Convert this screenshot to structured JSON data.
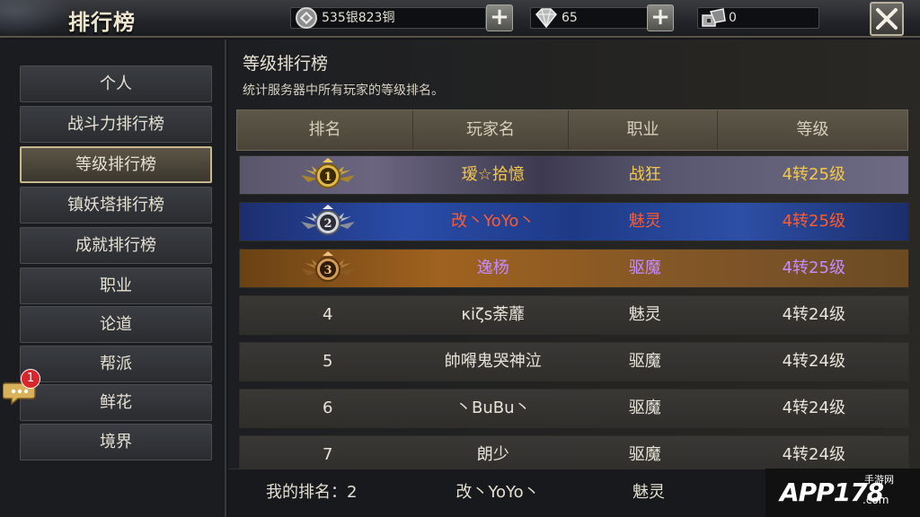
{
  "header": {
    "title": "排行榜",
    "silver": "535银823铜",
    "diamond": "65",
    "tickets": "0",
    "close_icon": "close-icon",
    "coin_icon": "silver-coin-icon",
    "diamond_icon": "diamond-icon",
    "ticket_icon": "ticket-icon"
  },
  "sidebar": {
    "items": [
      {
        "label": "个人",
        "active": false
      },
      {
        "label": "战斗力排行榜",
        "active": false
      },
      {
        "label": "等级排行榜",
        "active": true
      },
      {
        "label": "镇妖塔排行榜",
        "active": false
      },
      {
        "label": "成就排行榜",
        "active": false
      },
      {
        "label": "职业",
        "active": false
      },
      {
        "label": "论道",
        "active": false
      },
      {
        "label": "帮派",
        "active": false
      },
      {
        "label": "鲜花",
        "active": false
      },
      {
        "label": "境界",
        "active": false
      }
    ],
    "chat_badge": "1"
  },
  "main": {
    "title": "等级排行榜",
    "description": "统计服务器中所有玩家的等级排名。",
    "columns": [
      "排名",
      "玩家名",
      "职业",
      "等级"
    ],
    "rows": [
      {
        "rank": "1",
        "name": "瑷☆拾憶",
        "job": "战狂",
        "level": "4转25级",
        "style": "gold"
      },
      {
        "rank": "2",
        "name": "改丶YoYo丶",
        "job": "魅灵",
        "level": "4转25级",
        "style": "silver"
      },
      {
        "rank": "3",
        "name": "逸杨",
        "job": "驱魔",
        "level": "4转25级",
        "style": "bronze"
      },
      {
        "rank": "4",
        "name": "κiζs荼蘼",
        "job": "魅灵",
        "level": "4转24级",
        "style": "normal"
      },
      {
        "rank": "5",
        "name": "帥嘚鬼哭神泣",
        "job": "驱魔",
        "level": "4转24级",
        "style": "normal"
      },
      {
        "rank": "6",
        "name": "丶BuBu丶",
        "job": "驱魔",
        "level": "4转24级",
        "style": "normal"
      },
      {
        "rank": "7",
        "name": "朗少",
        "job": "驱魔",
        "level": "4转24级",
        "style": "normal"
      }
    ],
    "my_rank": {
      "label": "我的排名：2",
      "name": "改丶YoYo丶",
      "job": "魅灵"
    }
  },
  "watermark": {
    "logo": "APP178",
    "domain": ".com",
    "site": "手游网"
  }
}
